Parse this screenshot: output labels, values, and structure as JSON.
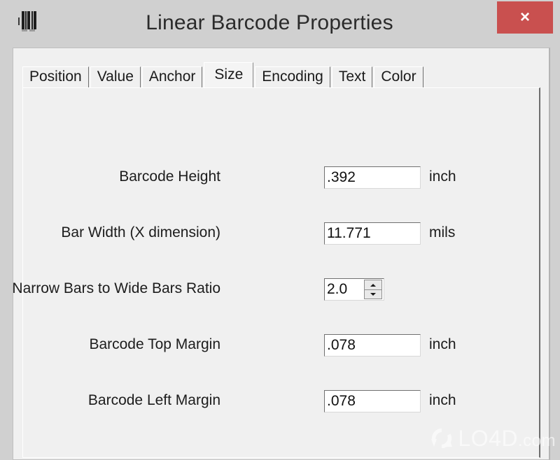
{
  "window": {
    "title": "Linear Barcode Properties",
    "icon": "barcode-icon",
    "close_label": "×",
    "close_icon": "close-icon",
    "close_color": "#c9504f",
    "titlebar_color": "#d0d0d0",
    "body_color": "#f0f0f0"
  },
  "tabs": [
    {
      "label": "Position",
      "active": false
    },
    {
      "label": "Value",
      "active": false
    },
    {
      "label": "Anchor",
      "active": false
    },
    {
      "label": "Size",
      "active": true
    },
    {
      "label": "Encoding",
      "active": false
    },
    {
      "label": "Text",
      "active": false
    },
    {
      "label": "Color",
      "active": false
    }
  ],
  "form": {
    "rows": [
      {
        "label": "Barcode Height",
        "value": ".392",
        "unit": "inch",
        "control": "text"
      },
      {
        "label": "Bar Width (X dimension)",
        "value": "11.771",
        "unit": "mils",
        "control": "text"
      },
      {
        "label": "Narrow Bars to Wide Bars Ratio",
        "value": "2.0",
        "unit": "",
        "control": "spinner"
      },
      {
        "label": "Barcode Top Margin",
        "value": ".078",
        "unit": "inch",
        "control": "text"
      },
      {
        "label": "Barcode Left Margin",
        "value": ".078",
        "unit": "inch",
        "control": "text"
      }
    ]
  },
  "watermark": {
    "name": "LO4D",
    "tld": ".com",
    "logo_icon": "refresh-arrows-icon"
  }
}
